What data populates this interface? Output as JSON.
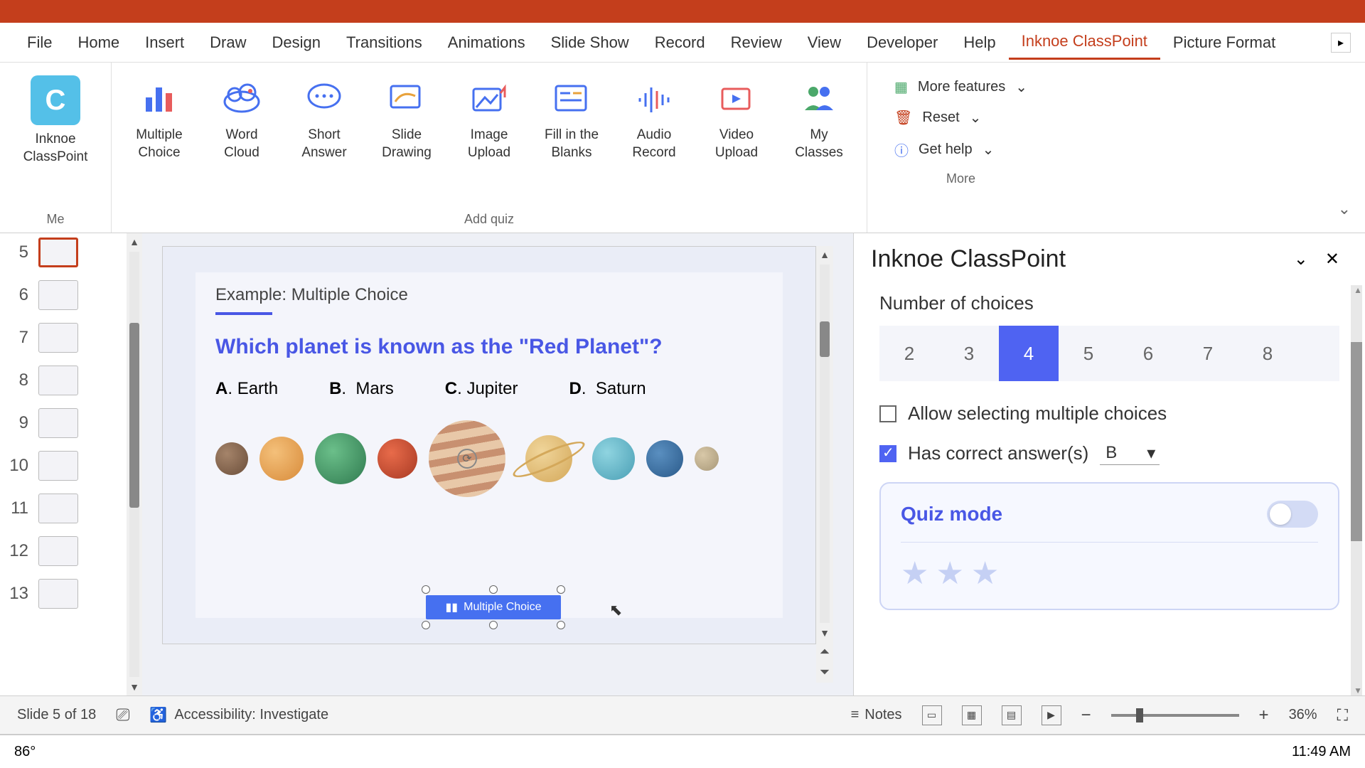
{
  "tabs": [
    "File",
    "Home",
    "Insert",
    "Draw",
    "Design",
    "Transitions",
    "Animations",
    "Slide Show",
    "Record",
    "Review",
    "View",
    "Developer",
    "Help",
    "Inknoe ClassPoint",
    "Picture Format"
  ],
  "active_tab": "Inknoe ClassPoint",
  "ribbon": {
    "me_group": {
      "title": "Me",
      "item": "Inknoe ClassPoint"
    },
    "quiz_group": {
      "title": "Add quiz",
      "items": [
        "Multiple Choice",
        "Word Cloud",
        "Short Answer",
        "Slide Drawing",
        "Image Upload",
        "Fill in the Blanks",
        "Audio Record",
        "Video Upload",
        "My Classes"
      ]
    },
    "more_group": {
      "title": "More",
      "more_features": "More features",
      "reset": "Reset",
      "get_help": "Get help"
    }
  },
  "thumbs": [
    5,
    6,
    7,
    8,
    9,
    10,
    11,
    12,
    13
  ],
  "active_slide": 5,
  "slide": {
    "label": "Example: Multiple Choice",
    "question": "Which planet is known as the \"Red Planet\"?",
    "choices": [
      {
        "letter": "A",
        "text": "Earth"
      },
      {
        "letter": "B",
        "text": "Mars"
      },
      {
        "letter": "C",
        "text": "Jupiter"
      },
      {
        "letter": "D",
        "text": "Saturn"
      }
    ],
    "button_label": "Multiple Choice"
  },
  "panel": {
    "title": "Inknoe ClassPoint",
    "num_choices_label": "Number of choices",
    "choices": [
      "2",
      "3",
      "4",
      "5",
      "6",
      "7",
      "8"
    ],
    "selected_choice": "4",
    "allow_multiple": "Allow selecting multiple choices",
    "has_correct": "Has correct answer(s)",
    "correct_value": "B",
    "quiz_mode": "Quiz mode"
  },
  "statusbar": {
    "slide_info": "Slide 5 of 18",
    "accessibility": "Accessibility: Investigate",
    "notes": "Notes",
    "zoom": "36%"
  },
  "taskbar": {
    "temp": "86°",
    "time": "11:49 AM"
  }
}
